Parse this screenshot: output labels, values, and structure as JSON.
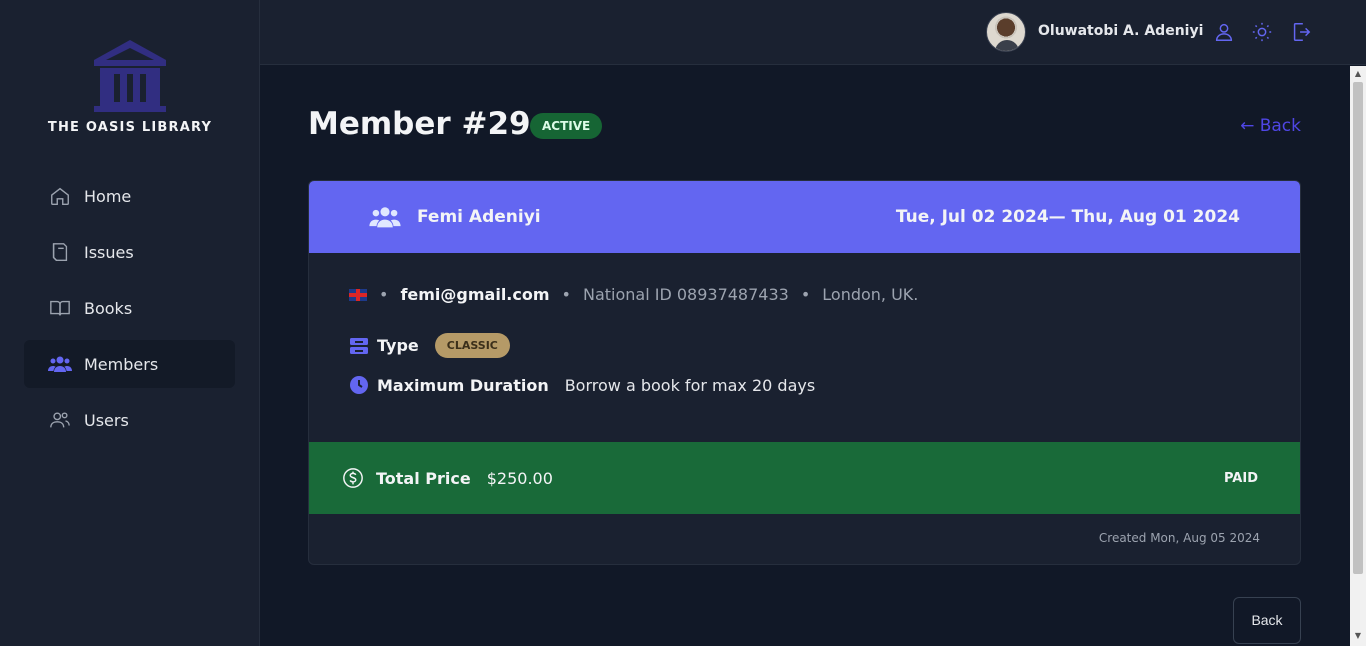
{
  "app": {
    "name": "THE OASIS LIBRARY"
  },
  "sidebar": {
    "items": [
      {
        "label": "Home",
        "icon": "home-icon",
        "active": false
      },
      {
        "label": "Issues",
        "icon": "book-stack-icon",
        "active": false
      },
      {
        "label": "Books",
        "icon": "open-book-icon",
        "active": false
      },
      {
        "label": "Members",
        "icon": "users-group-icon",
        "active": true
      },
      {
        "label": "Users",
        "icon": "users-outline-icon",
        "active": false
      }
    ]
  },
  "header": {
    "user_name": "Oluwatobi A. Adeniyi",
    "icons": [
      "user-icon",
      "sun-icon",
      "logout-icon"
    ]
  },
  "page": {
    "title": "Member #29",
    "status": "ACTIVE",
    "back_link": "← Back"
  },
  "member": {
    "name": "Femi Adeniyi",
    "period": "Tue, Jul 02 2024— Thu, Aug 01 2024",
    "email": "femi@gmail.com",
    "national_id": "National ID 08937487433",
    "location": "London, UK.",
    "type_label": "Type",
    "type_value": "CLASSIC",
    "duration_label": "Maximum Duration",
    "duration_value": "Borrow a book for max 20 days",
    "price_label": "Total Price",
    "price_value": "$250.00",
    "payment_status": "PAID",
    "created": "Created Mon, Aug 05 2024"
  },
  "footer": {
    "back_button": "Back"
  },
  "colors": {
    "accent": "#6366f1",
    "link": "#4f46e5",
    "success": "#196a39",
    "badge_classic": "#b59a67",
    "background": "#111827",
    "panel": "#1a2130"
  }
}
